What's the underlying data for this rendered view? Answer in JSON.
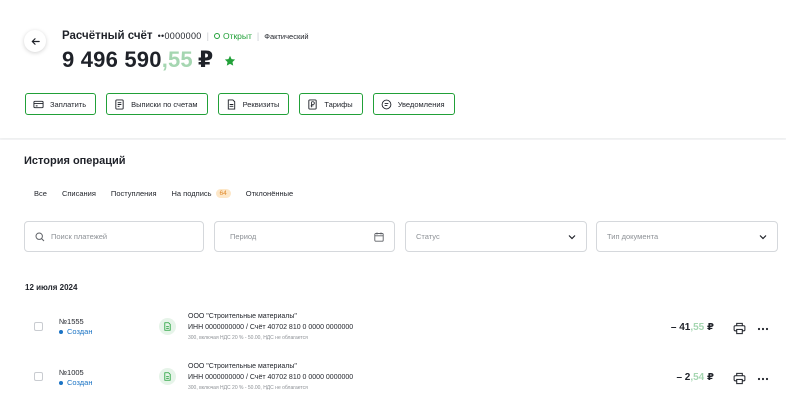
{
  "account": {
    "title": "Расчётный счёт",
    "mask": "••0000000",
    "status": "Открыт",
    "kind": "Фактический",
    "balance_int": "9 496 590",
    "balance_frac": ",55",
    "currency": "₽"
  },
  "actions": [
    {
      "label": "Заплатить",
      "icon": "card-icon"
    },
    {
      "label": "Выписки по счетам",
      "icon": "statement-icon"
    },
    {
      "label": "Реквизиты",
      "icon": "document-icon"
    },
    {
      "label": "Тарифы",
      "icon": "tariff-icon"
    },
    {
      "label": "Уведомления",
      "icon": "chat-icon"
    }
  ],
  "history": {
    "title": "История операций",
    "tabs": [
      "Все",
      "Списания",
      "Поступления",
      "На подпись",
      "Отклонённые"
    ],
    "pending_count": "64"
  },
  "filters": {
    "search_placeholder": "Поиск платежей",
    "period": "Период",
    "status": "Статус",
    "doc_type": "Тип документа"
  },
  "date_group": "12 июля 2024",
  "colors": {
    "accent": "#21a038",
    "link": "#1a73c4",
    "badge": "#fde7c8"
  },
  "operations": [
    {
      "number": "№1555",
      "status": "Создан",
      "payee": "ООО \"Строительные материалы\"",
      "details": "ИНН 0000000000 / Счёт 40702 810 0 0000 0000000",
      "note": "300, включая НДС 20 % - 50.00, НДС не облагается",
      "amount_int": "– 41",
      "amount_frac": ",55",
      "currency": "₽"
    },
    {
      "number": "№1005",
      "status": "Создан",
      "payee": "ООО \"Строительные материалы\"",
      "details": "ИНН 0000000000 / Счёт 40702 810 0 0000 0000000",
      "note": "300, включая НДС 20 % - 50.00, НДС не облагается",
      "amount_int": "– 2",
      "amount_frac": ",54",
      "currency": "₽"
    }
  ]
}
